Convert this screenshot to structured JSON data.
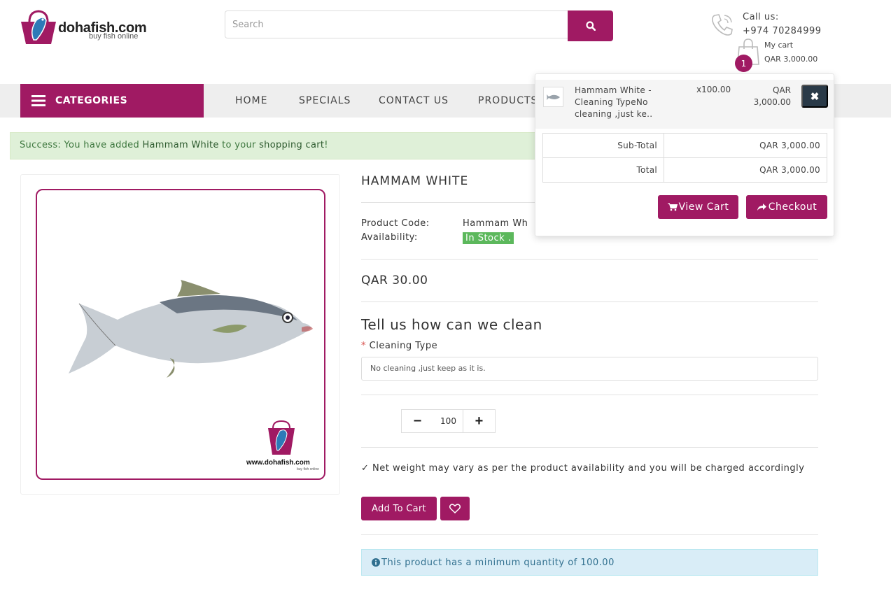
{
  "header": {
    "brand": "dohafish.com",
    "tagline": "buy fish online",
    "search_placeholder": "Search",
    "call_label": "Call us:",
    "call_number": "+974 70284999",
    "cart_label": "My cart",
    "cart_total": "QAR 3,000.00",
    "cart_count": "1"
  },
  "nav": {
    "categories": "CATEGORIES",
    "items": [
      "HOME",
      "SPECIALS",
      "CONTACT US",
      "PRODUCTS"
    ]
  },
  "alert_success": {
    "prefix": "Success: You have added ",
    "product": "Hammam White",
    "middle": " to your ",
    "cart_link": "shopping cart",
    "suffix": "!"
  },
  "product": {
    "image_brand": "www.dohafish.com",
    "image_tagline": "buy fish online",
    "title": "HAMMAM WHITE",
    "code_label": "Product Code:",
    "code_value": "Hammam Wh",
    "availability_label": "Availability:",
    "availability_value": "In Stock .",
    "price": "QAR 30.00",
    "option_heading": "Tell us how can we clean",
    "option_required": "*",
    "option_label": "Cleaning Type",
    "option_value": "No cleaning ,just keep as it is.",
    "qty": "100",
    "qty_minus": "−",
    "qty_plus": "+",
    "note": "✓ Net weight may vary as per the product availability and you will be charged accordingly",
    "add_to_cart": "Add To Cart",
    "min_qty_notice": "This product has a minimum quantity of 100.00"
  },
  "cart_dropdown": {
    "item_name": "Hammam White - Cleaning TypeNo cleaning ,just ke..",
    "item_qty": "x100.00",
    "item_price": "QAR 3,000.00",
    "remove": "✖",
    "subtotal_label": "Sub-Total",
    "subtotal_value": "QAR 3,000.00",
    "total_label": "Total",
    "total_value": "QAR 3,000.00",
    "view_cart": "View Cart",
    "checkout": "Checkout"
  },
  "colors": {
    "brand": "#a01a63",
    "stock_green": "#5cb85c",
    "remove_dark": "#2a3a48"
  },
  "icons": [
    "fish-basket-logo-icon",
    "search-icon",
    "phone-icon",
    "shopping-bag-icon",
    "hamburger-icon",
    "heart-icon",
    "info-icon",
    "cart-icon",
    "share-icon",
    "close-icon"
  ]
}
